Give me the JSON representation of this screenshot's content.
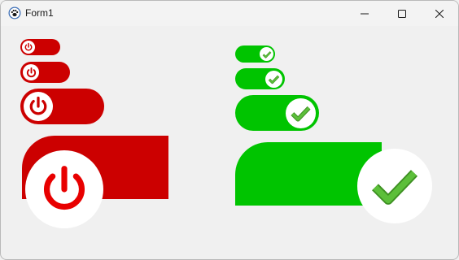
{
  "window": {
    "title": "Form1",
    "icon": "paw-icon"
  },
  "controls": {
    "minimize_icon": "minimize-icon",
    "maximize_icon": "maximize-icon",
    "close_icon": "close-icon"
  },
  "toggles_off": [
    {
      "state": "off",
      "icon": "power-icon",
      "color": "#cc0000"
    },
    {
      "state": "off",
      "icon": "power-icon",
      "color": "#cc0000"
    },
    {
      "state": "off",
      "icon": "power-icon",
      "color": "#cc0000"
    },
    {
      "state": "off",
      "icon": "power-icon",
      "color": "#cc0000"
    }
  ],
  "toggles_on": [
    {
      "state": "on",
      "icon": "check-icon",
      "color": "#00c400"
    },
    {
      "state": "on",
      "icon": "check-icon",
      "color": "#00c400"
    },
    {
      "state": "on",
      "icon": "check-icon",
      "color": "#00c400"
    },
    {
      "state": "on",
      "icon": "check-icon",
      "color": "#00c400"
    }
  ],
  "colors": {
    "off_track": "#cc0000",
    "on_track": "#00c400",
    "check": "#5cbf3a",
    "check_outline": "#3d8f22"
  }
}
